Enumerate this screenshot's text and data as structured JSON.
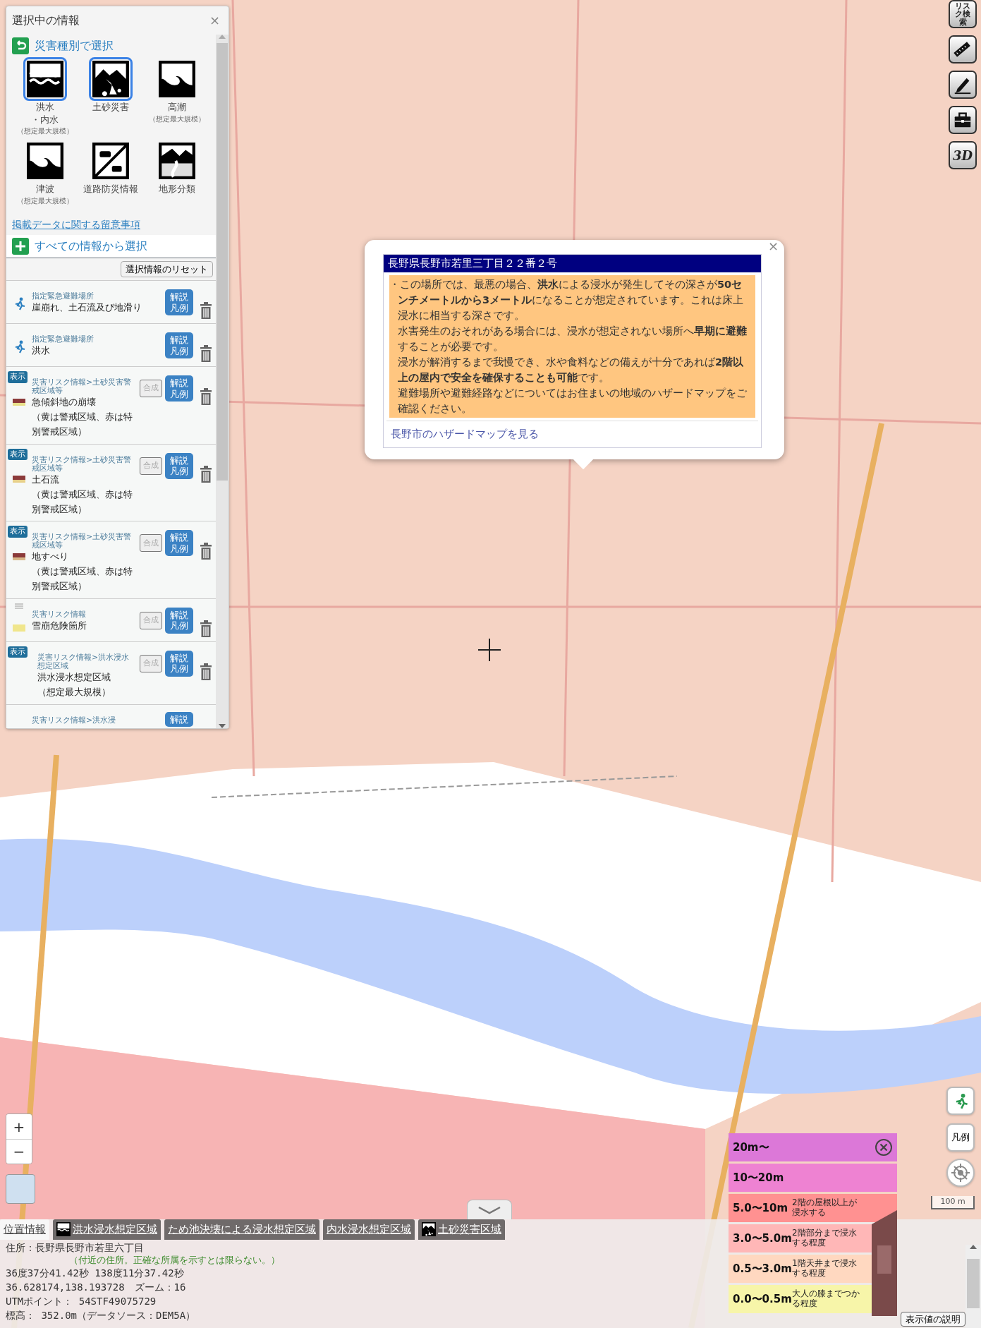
{
  "panel": {
    "title": "選択中の情報",
    "close": "×",
    "hazard_section": {
      "title": "災害種別で選択",
      "items": [
        {
          "kind": "flood",
          "label": "洪水",
          "label_2": "・内水",
          "note": "（想定最大規模）",
          "selected": true
        },
        {
          "kind": "sediment",
          "label": "土砂災害",
          "selected": true
        },
        {
          "kind": "surge",
          "label": "高潮",
          "note": "（想定最大規模）",
          "selected": false
        },
        {
          "kind": "tsunami",
          "label": "津波",
          "note": "（想定最大規模）",
          "selected": false
        },
        {
          "kind": "road",
          "label": "道路防災情報",
          "selected": false
        },
        {
          "kind": "terrain",
          "label": "地形分類",
          "selected": false
        }
      ]
    },
    "notice_link": "掲載データに関する留意事項",
    "all_section": {
      "title": "すべての情報から選択"
    },
    "reset_button": "選択情報のリセット",
    "layers": [
      {
        "kind": "evacuation",
        "category": "指定緊急避難場所",
        "name": "崖崩れ、土石流及び地滑り",
        "legend_button": "解説凡例"
      },
      {
        "kind": "evacuation",
        "category": "指定緊急避難場所",
        "name": "洪水",
        "legend_button": "解説凡例"
      },
      {
        "kind": "area",
        "badge": "表示",
        "category": "災害リスク情報>土砂災害警戒区域等",
        "name": "急傾斜地の崩壊",
        "note": "（黄は警戒区域、赤は特別警戒区域）",
        "stripes": [
          {
            "color": "#8b3a3a"
          },
          {
            "color": "#e8e08a"
          }
        ],
        "merge_button": "合成",
        "legend_button": "解説凡例"
      },
      {
        "kind": "area",
        "badge": "表示",
        "category": "災害リスク情報>土砂災害警戒区域等",
        "name": "土石流",
        "note": "（黄は警戒区域、赤は特別警戒区域）",
        "stripes": [
          {
            "color": "#8b3a3a"
          },
          {
            "color": "#e8d08a"
          }
        ],
        "merge_button": "合成",
        "legend_button": "解説凡例"
      },
      {
        "kind": "area",
        "badge": "表示",
        "category": "災害リスク情報>土砂災害警戒区域等",
        "name": "地すべり",
        "note": "（黄は警戒区域、赤は特別警戒区域）",
        "stripes": [
          {
            "color": "#8b3a3a"
          },
          {
            "color": "#d8b88a"
          }
        ],
        "merge_button": "合成",
        "legend_button": "解説凡例"
      },
      {
        "kind": "area",
        "handle": true,
        "category": "災害リスク情報",
        "name": "雪崩危険箇所",
        "color": "#f0e68c",
        "merge_button": "合成",
        "legend_button": "解説凡例"
      },
      {
        "kind": "plain",
        "badge": "表示",
        "category": "災害リスク情報>洪水浸水想定区域",
        "name": "洪水浸水想定区域",
        "note": "（想定最大規模）",
        "merge_button": "合成",
        "legend_button": "解説凡例"
      },
      {
        "kind": "cut",
        "category": "災害リスク情報>洪水浸",
        "legend_button": "解説"
      }
    ]
  },
  "popup": {
    "title": "長野県長野市若里三丁目２２番２号",
    "close": "×",
    "paragraphs": [
      "・この場所では、最悪の場合、**洪水**による浸水が発生してその深さが**50センチメートルから3メートル**になることが想定されています。これは床上浸水に相当する深さです。",
      "水害発生のおそれがある場合には、浸水が想定されない場所へ**早期に避難**することが必要です。",
      "浸水が解消するまで我慢でき、水や食料などの備えが十分であれば**2階以上の屋内で安全を確保することも可能**です。",
      "避難場所や避難経路などについてはお住まいの地域のハザードマップをご確認ください。"
    ],
    "link": "長野市のハザードマップを見る"
  },
  "toolbar": [
    {
      "kind": "text",
      "label": "リスク検索"
    },
    {
      "kind": "ruler"
    },
    {
      "kind": "pencil"
    },
    {
      "kind": "toolbox"
    },
    {
      "kind": "text3d",
      "label": "3D"
    }
  ],
  "map_controls": {
    "zoom_in": "+",
    "zoom_out": "−",
    "legend_button": "凡例",
    "scale": "100 m"
  },
  "legend": {
    "items": [
      {
        "label": "20m〜",
        "color": "#dc78d8",
        "close": true
      },
      {
        "label": "10〜20m",
        "color": "#ee82d2"
      },
      {
        "label": "5.0〜10m",
        "desc": "2階の屋根以上が浸水する",
        "color": "#ff9191"
      },
      {
        "label": "3.0〜5.0m",
        "desc": "2階部分まで浸水する程度",
        "color": "#ffb7b7"
      },
      {
        "label": "0.5〜3.0m",
        "desc": "1階天井まで浸水する程度",
        "color": "#ffd8c0"
      },
      {
        "label": "0.0〜0.5m",
        "desc": "大人の膝までつかる程度",
        "color": "#f7f5a9"
      }
    ]
  },
  "bottom_panel": {
    "tabs": [
      {
        "label": "位置情報",
        "selected": true
      },
      {
        "label": "洪水浸水想定区域",
        "kind": "flood",
        "selected": false
      },
      {
        "label": "ため池決壊による浸水想定区域",
        "selected": false
      },
      {
        "label": "内水浸水想定区域",
        "selected": false
      },
      {
        "label": "土砂災害区域",
        "kind": "sediment",
        "selected": false
      }
    ],
    "address": "住所：長野県長野市若里六丁目",
    "address_note": "（付近の住所。正確な所属を示すとは限らない。）",
    "lines": [
      "36度37分41.42秒 138度11分37.42秒",
      "36.628174,138.193728　ズーム：16",
      "UTMポイント： 54STF49075729",
      "標高： 352.0m（データソース：DEM5A）"
    ],
    "explain_button": "表示値の説明"
  }
}
